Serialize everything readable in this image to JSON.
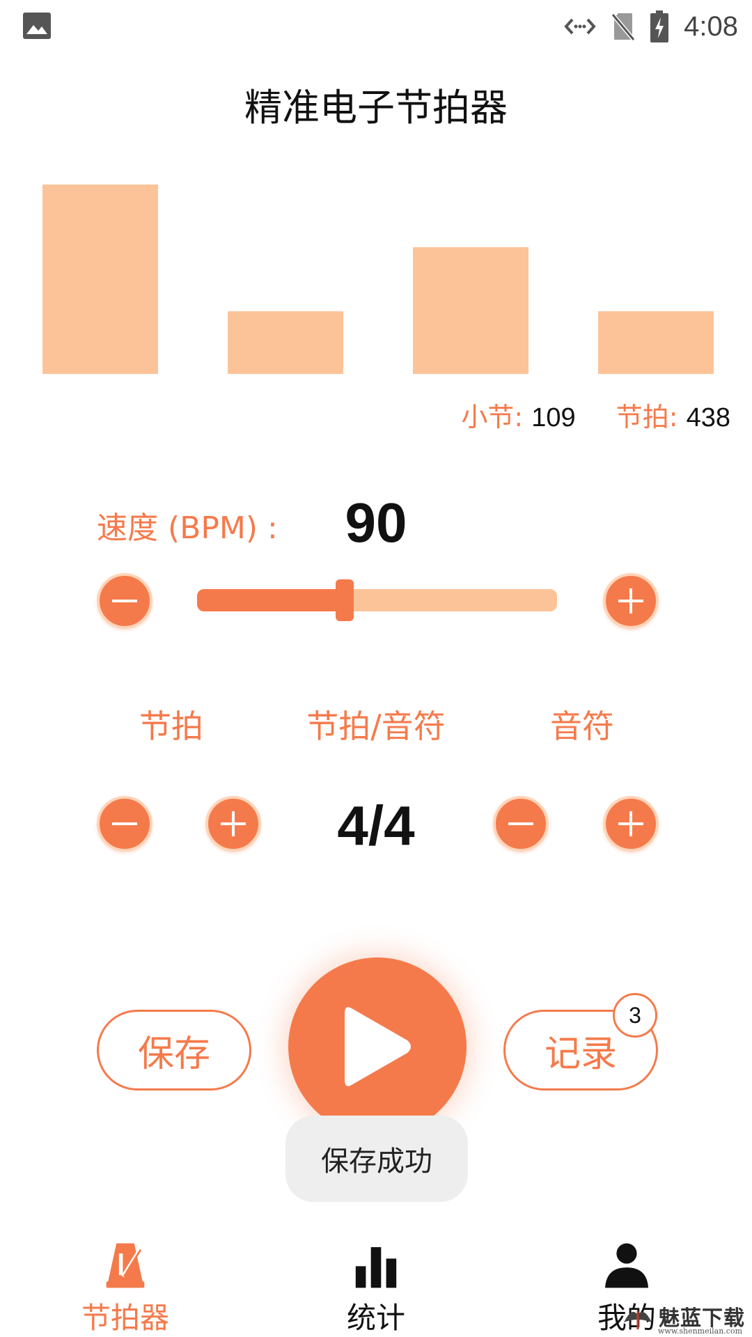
{
  "status_bar": {
    "time": "4:08",
    "icons": [
      "gallery-icon",
      "data-saver-icon",
      "no-sim-icon",
      "battery-charging-icon"
    ]
  },
  "app": {
    "title": "精准电子节拍器"
  },
  "beat_levels": [
    1.0,
    0.33,
    0.67,
    0.33
  ],
  "counters": {
    "measure_label": "小节:",
    "measure_value": "109",
    "beat_label": "节拍:",
    "beat_value": "438"
  },
  "tempo": {
    "label": "速度 (BPM) :",
    "value": "90",
    "slider_fraction": 0.41
  },
  "time_signature": {
    "beats_label": "节拍",
    "center_label": "节拍/音符",
    "note_label": "音符",
    "value": "4/4"
  },
  "actions": {
    "save_label": "保存",
    "history_label": "记录",
    "history_badge": "3"
  },
  "toast": {
    "message": "保存成功"
  },
  "bottom_nav": {
    "metronome_label": "节拍器",
    "stats_label": "统计",
    "mine_label": "我的"
  },
  "watermark": {
    "text": "魅蓝下载",
    "url": "www.shenmeilan.com"
  },
  "colors": {
    "accent": "#f57a4b",
    "accent_light": "#fdc398",
    "text": "#111111",
    "toast_bg": "#eeeeee"
  }
}
